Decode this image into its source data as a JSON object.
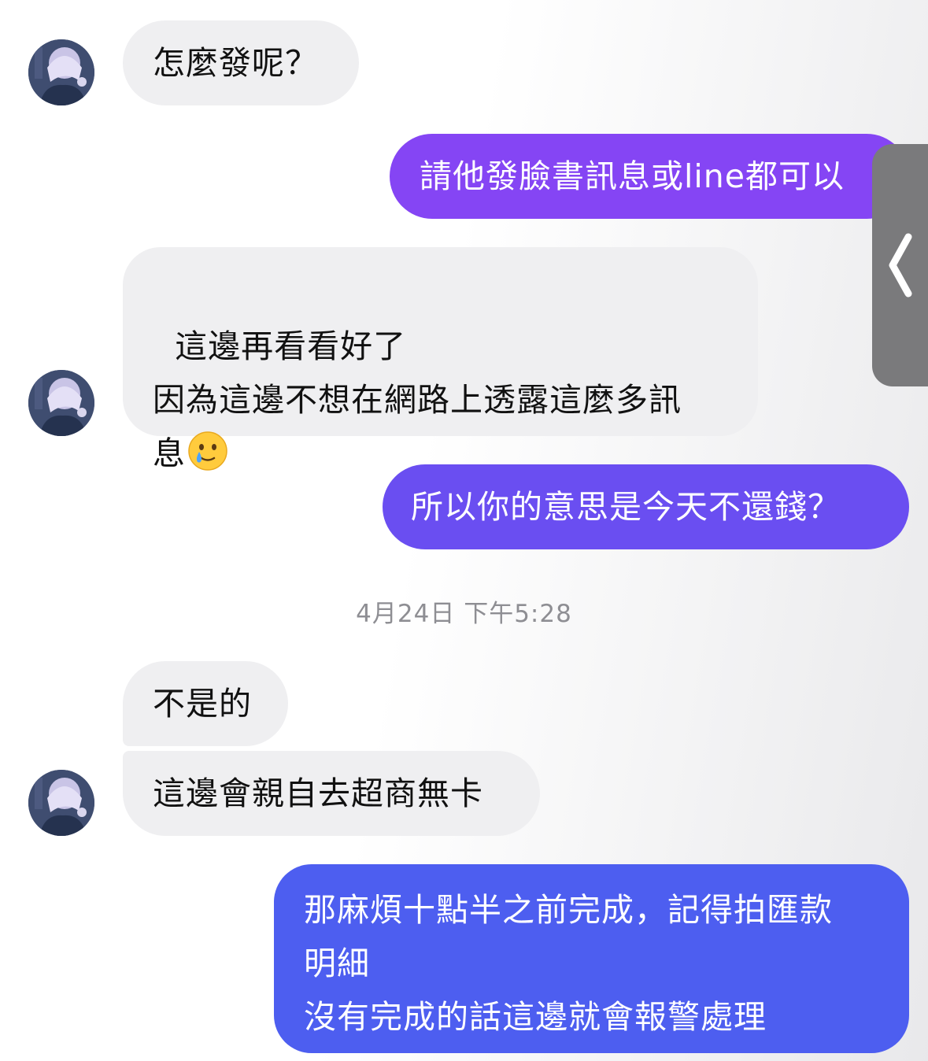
{
  "messages": [
    {
      "text": "怎麼發呢？"
    },
    {
      "text": "請他發臉書訊息或line都可以"
    },
    {
      "text": "這邊再看看好了\n因為這邊不想在網路上透露這麼多訊\n息"
    },
    {
      "text": "所以你的意思是今天不還錢？"
    },
    {
      "text": "不是的"
    },
    {
      "text": "這邊會親自去超商無卡"
    },
    {
      "text": "那麻煩十點半之前完成，記得拍匯款\n明細\n沒有完成的話這邊就會報警處理"
    }
  ],
  "timestamp": "4月24日 下午5:28",
  "emoji": "crying-smile-emoji",
  "side_tab_icon": "chevron-left-icon",
  "colors": {
    "incoming_bubble": "#efeff1",
    "outgoing_top": "#8a45f5",
    "outgoing_mid": "#6a4ef0",
    "outgoing_bottom": "#4e5ef0",
    "timestamp": "#8e8e93"
  }
}
